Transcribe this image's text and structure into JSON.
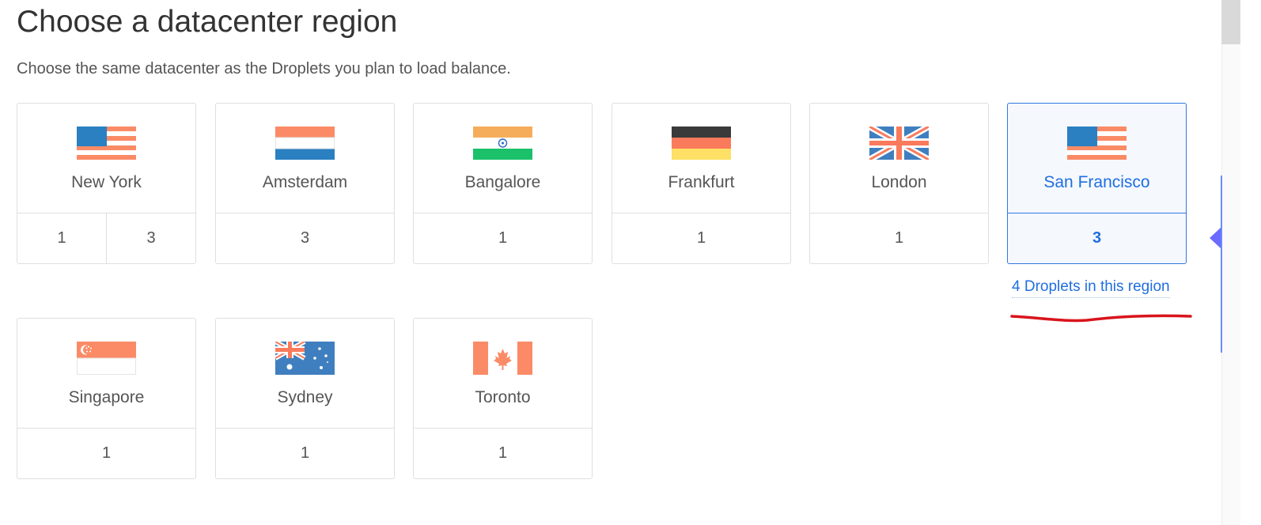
{
  "header": {
    "title": "Choose a datacenter region",
    "subtitle": "Choose the same datacenter as the Droplets you plan to load balance."
  },
  "regions": [
    {
      "name": "New York",
      "flag": "usa-flag",
      "options": [
        "1",
        "3"
      ],
      "selected": false
    },
    {
      "name": "Amsterdam",
      "flag": "netherlands-flag",
      "options": [
        "3"
      ],
      "selected": false
    },
    {
      "name": "Bangalore",
      "flag": "india-flag",
      "options": [
        "1"
      ],
      "selected": false
    },
    {
      "name": "Frankfurt",
      "flag": "germany-flag",
      "options": [
        "1"
      ],
      "selected": false
    },
    {
      "name": "London",
      "flag": "uk-flag",
      "options": [
        "1"
      ],
      "selected": false
    },
    {
      "name": "San Francisco",
      "flag": "usa-flag",
      "options": [
        "3"
      ],
      "selected": true
    },
    {
      "name": "Singapore",
      "flag": "singapore-flag",
      "options": [
        "1"
      ],
      "selected": false
    },
    {
      "name": "Sydney",
      "flag": "australia-flag",
      "options": [
        "1"
      ],
      "selected": false
    },
    {
      "name": "Toronto",
      "flag": "canada-flag",
      "options": [
        "1"
      ],
      "selected": false
    }
  ],
  "selected_region_info": {
    "droplets_link": "4 Droplets in this region"
  },
  "colors": {
    "accent": "#1f6ee0",
    "card_border": "#dfdfdf",
    "selected_bg": "#f5f8fd",
    "annotation": "#d9141c"
  }
}
